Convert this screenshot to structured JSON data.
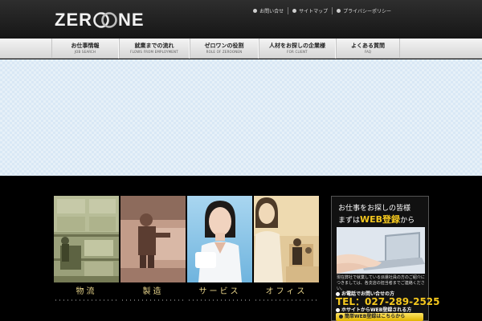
{
  "header": {
    "logo_left": "ZER",
    "logo_right": "NE",
    "top_links": [
      {
        "label": "お問い合せ"
      },
      {
        "label": "サイトマップ"
      },
      {
        "label": "プライバシーポリシー"
      }
    ]
  },
  "nav": {
    "items": [
      {
        "jp": "お仕事情報",
        "en": "JOB SEARCH"
      },
      {
        "jp": "就業までの流れ",
        "en": "FLOWS FROM EMPLOYMENT"
      },
      {
        "jp": "ゼロワンの役割",
        "en": "ROLE OF ZEROONEN"
      },
      {
        "jp": "人材をお探しの企業様",
        "en": "FOR CLIENT"
      },
      {
        "jp": "よくある質問",
        "en": "FAQ"
      }
    ]
  },
  "tiles": [
    {
      "label": "物流",
      "desc": "・・・・・・・・・・・・・・・・・・・・・・・・・・・・・・・・・・・・・・・・・・・・・・"
    },
    {
      "label": "製造",
      "desc": "・・・・・・・・・・・・・・・・・・・・・・・・・・・・・・・・・・・・・・・・・・・・・・"
    },
    {
      "label": "サービス",
      "desc": "・・・・・・・・・・・・・・・・・・・・・・・・・・・・・・・・・・・・・・・・・・・・・・"
    },
    {
      "label": "オフィス",
      "desc": "・・・・・・・・・・・・・・・・・・・・・・・・・・・・・・・・・・・・・・・・・・・・・・"
    }
  ],
  "side": {
    "line1": "お仕事をお探しの皆様",
    "line2_pre": "まずは",
    "line2_hl": "WEB登録",
    "line2_post": "から",
    "body": "現在弊社で就業している派遣社員の方のご紹介につきましては、各支店の担当者までご連絡ください。",
    "tel_label": "お電話でお問い合せの方",
    "tel": "TEL：027-289-2525",
    "web_label": "ホサイトからWEB登録される方",
    "button": "簡単WEB登録はこちらから"
  }
}
